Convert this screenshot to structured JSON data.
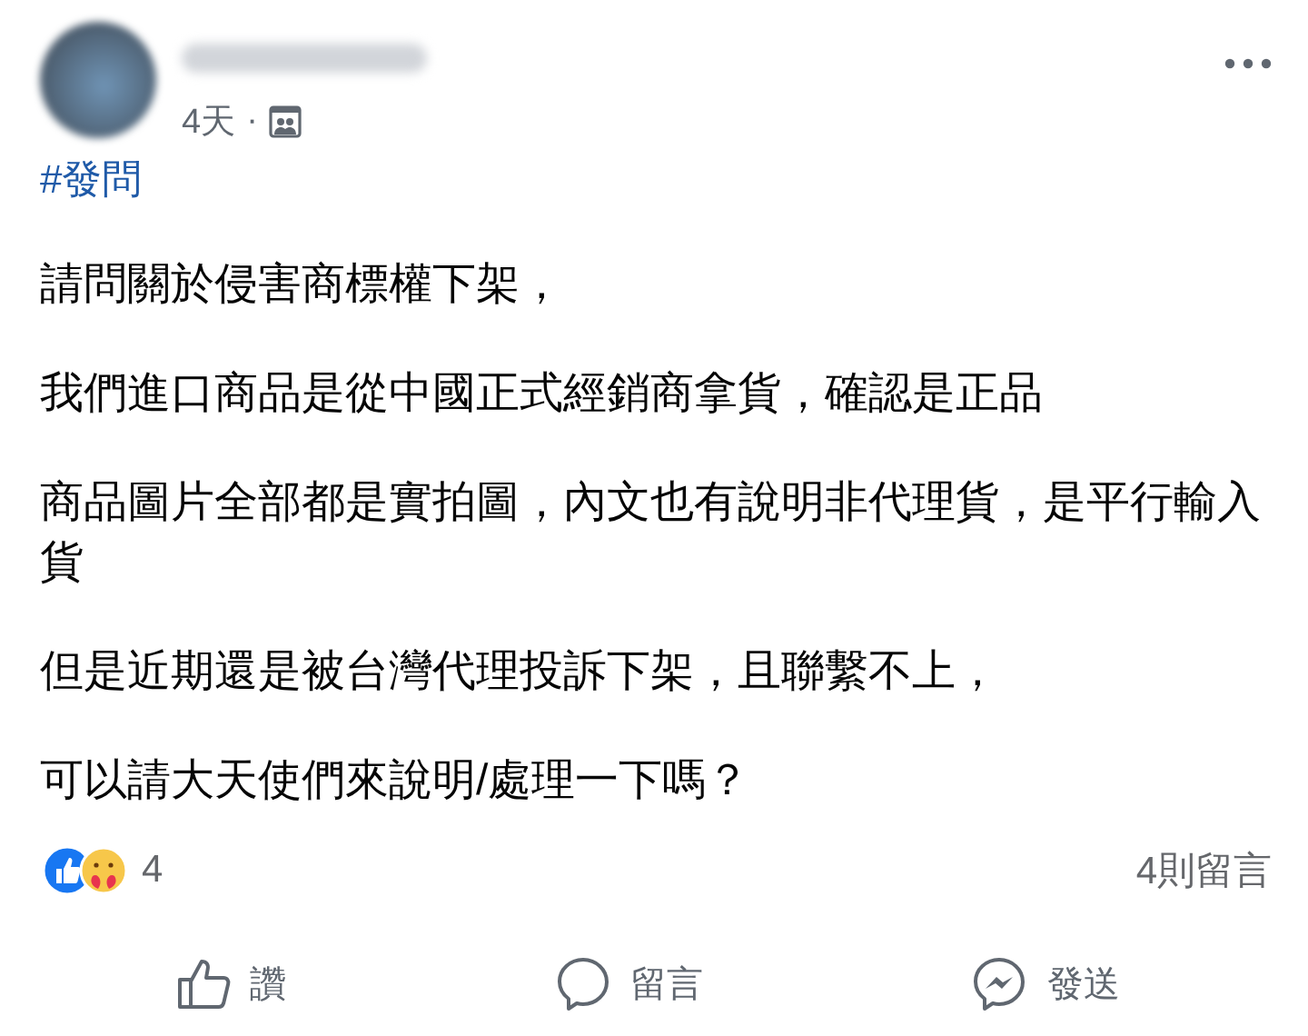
{
  "post": {
    "time": "4天",
    "separator": "·",
    "hashtag": "#發問",
    "paragraphs": [
      "請問關於侵害商標權下架，",
      "我們進口商品是從中國正式經銷商拿貨，確認是正品",
      "商品圖片全部都是實拍圖，內文也有說明非代理貨，是平行輸入貨",
      "但是近期還是被台灣代理投訴下架，且聯繫不上，",
      "可以請大天使們來說明/處理一下嗎？"
    ]
  },
  "reactions": {
    "count": "4",
    "comments": "4則留言"
  },
  "actions": [
    {
      "kind": "like",
      "label": "讚"
    },
    {
      "kind": "comment",
      "label": "留言"
    },
    {
      "kind": "send",
      "label": "發送"
    }
  ]
}
